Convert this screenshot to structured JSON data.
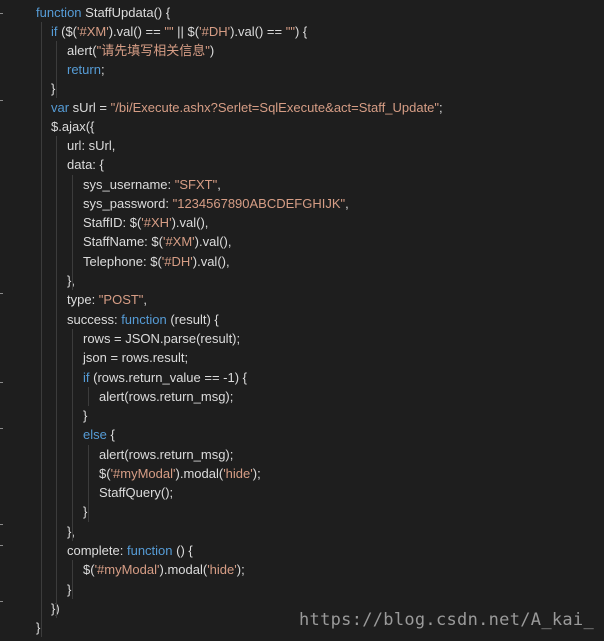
{
  "editor": {
    "lines": [
      [
        {
          "t": "function",
          "c": "kw"
        },
        {
          "t": " StaffUpdata() {",
          "c": "plain"
        }
      ],
      [
        {
          "t": "if",
          "c": "kw"
        },
        {
          "t": " ($(",
          "c": "plain"
        },
        {
          "t": "'#XM'",
          "c": "str"
        },
        {
          "t": ").val() == ",
          "c": "plain"
        },
        {
          "t": "\"\"",
          "c": "str"
        },
        {
          "t": " || $(",
          "c": "plain"
        },
        {
          "t": "'#DH'",
          "c": "str"
        },
        {
          "t": ").val() == ",
          "c": "plain"
        },
        {
          "t": "\"\"",
          "c": "str"
        },
        {
          "t": ") {",
          "c": "plain"
        }
      ],
      [
        {
          "t": "alert(",
          "c": "plain"
        },
        {
          "t": "\"请先填写相关信息\"",
          "c": "str"
        },
        {
          "t": ")",
          "c": "plain"
        }
      ],
      [
        {
          "t": "return",
          "c": "kw"
        },
        {
          "t": ";",
          "c": "plain"
        }
      ],
      [
        {
          "t": "}",
          "c": "plain"
        }
      ],
      [
        {
          "t": "var",
          "c": "kw"
        },
        {
          "t": " sUrl = ",
          "c": "plain"
        },
        {
          "t": "\"/bi/Execute.ashx?Serlet=SqlExecute&act=Staff_Update\"",
          "c": "str"
        },
        {
          "t": ";",
          "c": "plain"
        }
      ],
      [
        {
          "t": "$.ajax({",
          "c": "plain"
        }
      ],
      [
        {
          "t": "url: sUrl,",
          "c": "plain"
        }
      ],
      [
        {
          "t": "data: {",
          "c": "plain"
        }
      ],
      [
        {
          "t": "sys_username: ",
          "c": "plain"
        },
        {
          "t": "\"SFXT\"",
          "c": "str"
        },
        {
          "t": ",",
          "c": "plain"
        }
      ],
      [
        {
          "t": "sys_password: ",
          "c": "plain"
        },
        {
          "t": "\"1234567890ABCDEFGHIJK\"",
          "c": "str"
        },
        {
          "t": ",",
          "c": "plain"
        }
      ],
      [
        {
          "t": "StaffID: $(",
          "c": "plain"
        },
        {
          "t": "'#XH'",
          "c": "str"
        },
        {
          "t": ").val(),",
          "c": "plain"
        }
      ],
      [
        {
          "t": "StaffName: $(",
          "c": "plain"
        },
        {
          "t": "'#XM'",
          "c": "str"
        },
        {
          "t": ").val(),",
          "c": "plain"
        }
      ],
      [
        {
          "t": "Telephone: $(",
          "c": "plain"
        },
        {
          "t": "'#DH'",
          "c": "str"
        },
        {
          "t": ").val(),",
          "c": "plain"
        }
      ],
      [
        {
          "t": "},",
          "c": "plain"
        }
      ],
      [
        {
          "t": "type: ",
          "c": "plain"
        },
        {
          "t": "\"POST\"",
          "c": "str"
        },
        {
          "t": ",",
          "c": "plain"
        }
      ],
      [
        {
          "t": "success: ",
          "c": "plain"
        },
        {
          "t": "function",
          "c": "kw"
        },
        {
          "t": " (result) {",
          "c": "plain"
        }
      ],
      [
        {
          "t": "rows = JSON.parse(result);",
          "c": "plain"
        }
      ],
      [
        {
          "t": "json = rows.result;",
          "c": "plain"
        }
      ],
      [
        {
          "t": "if",
          "c": "kw"
        },
        {
          "t": " (rows.return_value == -1) {",
          "c": "plain"
        }
      ],
      [
        {
          "t": "alert(rows.return_msg);",
          "c": "plain"
        }
      ],
      [
        {
          "t": "}",
          "c": "plain"
        }
      ],
      [
        {
          "t": "else",
          "c": "kw"
        },
        {
          "t": " {",
          "c": "plain"
        }
      ],
      [
        {
          "t": "alert(rows.return_msg);",
          "c": "plain"
        }
      ],
      [
        {
          "t": "$(",
          "c": "plain"
        },
        {
          "t": "'#myModal'",
          "c": "str"
        },
        {
          "t": ").modal(",
          "c": "plain"
        },
        {
          "t": "'hide'",
          "c": "str"
        },
        {
          "t": ");",
          "c": "plain"
        }
      ],
      [
        {
          "t": "StaffQuery();",
          "c": "plain"
        }
      ],
      [
        {
          "t": "}",
          "c": "plain"
        }
      ],
      [
        {
          "t": "},",
          "c": "plain"
        }
      ],
      [
        {
          "t": "complete: ",
          "c": "plain"
        },
        {
          "t": "function",
          "c": "kw"
        },
        {
          "t": " () {",
          "c": "plain"
        }
      ],
      [
        {
          "t": "$(",
          "c": "plain"
        },
        {
          "t": "'#myModal'",
          "c": "str"
        },
        {
          "t": ").modal(",
          "c": "plain"
        },
        {
          "t": "'hide'",
          "c": "str"
        },
        {
          "t": ");",
          "c": "plain"
        }
      ],
      [
        {
          "t": "}",
          "c": "plain"
        }
      ],
      [
        {
          "t": "})",
          "c": "plain"
        }
      ],
      [
        {
          "t": "}",
          "c": "plain"
        }
      ]
    ]
  },
  "watermark": "https://blog.csdn.net/A_kai_",
  "colors": {
    "background": "#1e1e1e",
    "keyword": "#569cd6",
    "string": "#d69d85",
    "text": "#dcdcdc"
  }
}
